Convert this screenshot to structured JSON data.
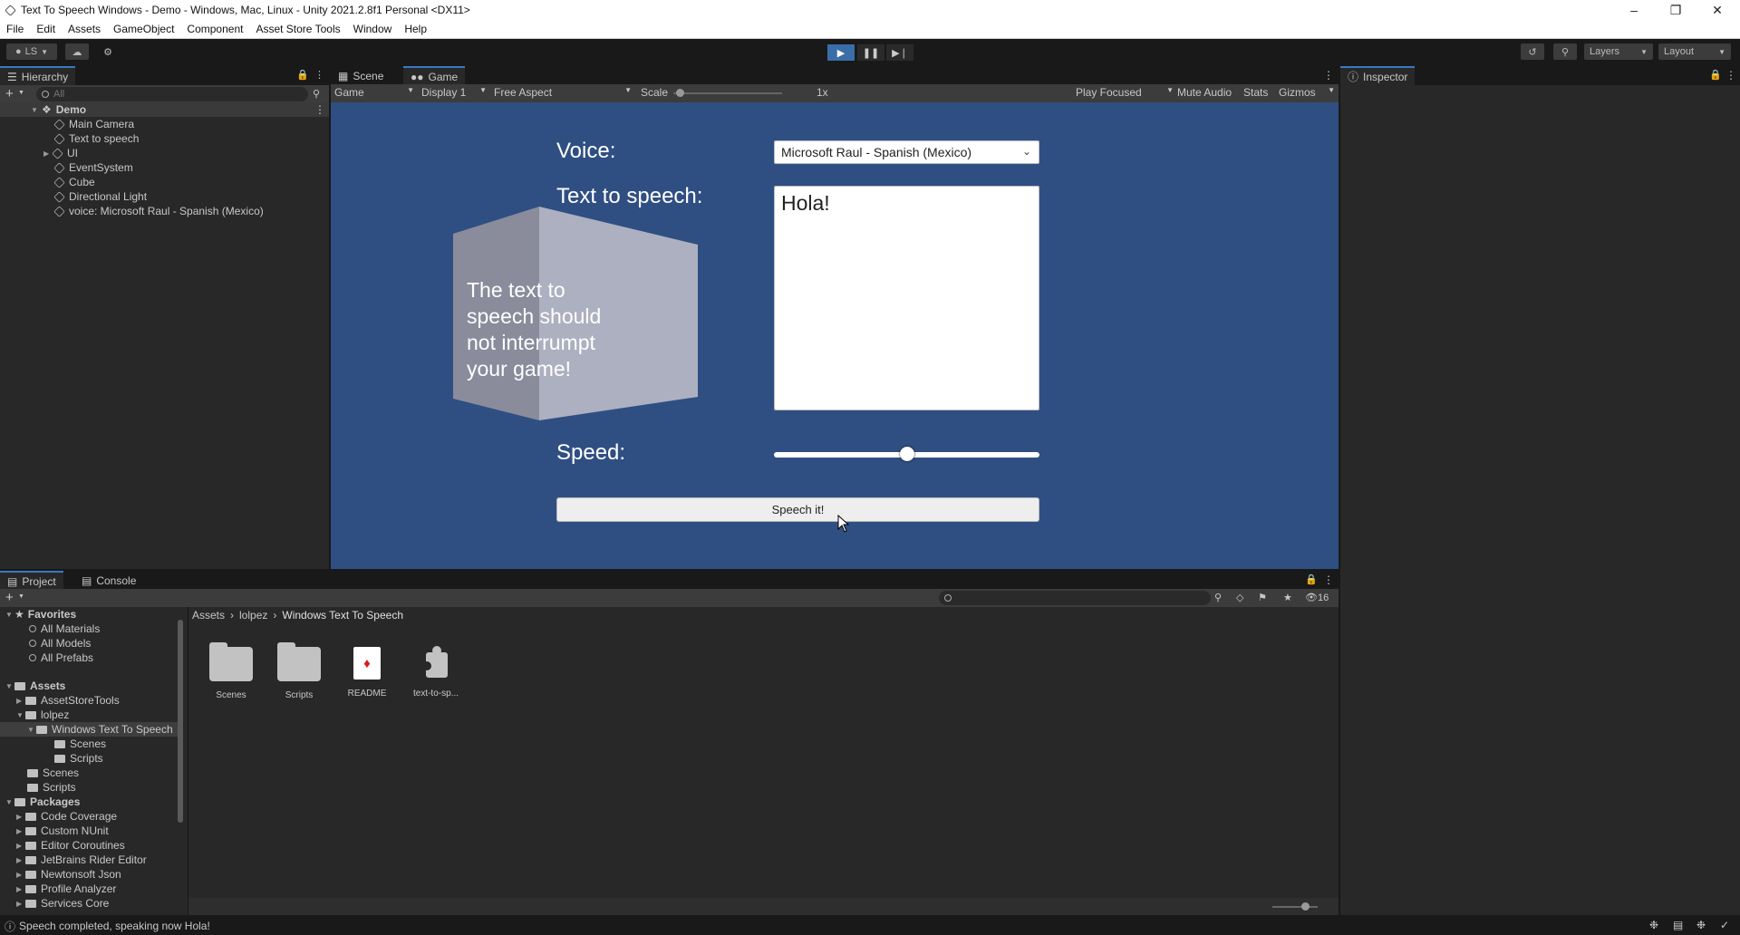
{
  "window": {
    "title": "Text To Speech Windows - Demo - Windows, Mac, Linux - Unity 2021.2.8f1 Personal <DX11>"
  },
  "menu": [
    "File",
    "Edit",
    "Assets",
    "GameObject",
    "Component",
    "Asset Store Tools",
    "Window",
    "Help"
  ],
  "toolbar": {
    "account": "LS",
    "layers": "Layers",
    "layout": "Layout"
  },
  "hierarchy": {
    "tab": "Hierarchy",
    "search_placeholder": "All",
    "scene": "Demo",
    "items": [
      "Main Camera",
      "Text to speech",
      "UI",
      "EventSystem",
      "Cube",
      "Directional Light",
      "voice: Microsoft Raul - Spanish (Mexico)"
    ]
  },
  "tabs": {
    "scene": "Scene",
    "game": "Game",
    "inspector": "Inspector",
    "project": "Project",
    "console": "Console"
  },
  "game_bar": {
    "game": "Game",
    "display": "Display 1",
    "aspect": "Free Aspect",
    "scale_label": "Scale",
    "scale_value": "1x",
    "play_focused": "Play Focused",
    "mute_audio": "Mute Audio",
    "stats": "Stats",
    "gizmos": "Gizmos"
  },
  "game": {
    "voice_label": "Voice:",
    "voice_value": "Microsoft Raul - Spanish (Mexico)",
    "tts_label": "Text to speech:",
    "tts_value": "Hola!",
    "cube_text": "The text to speech should not interrumpt your game!",
    "speed_label": "Speed:",
    "speed_value": 0.5,
    "button": "Speech it!"
  },
  "project": {
    "favorites": "Favorites",
    "favorite_items": [
      "All Materials",
      "All Models",
      "All Prefabs"
    ],
    "assets": "Assets",
    "asset_tree": [
      "AssetStoreTools",
      "lolpez",
      "Windows Text To Speech",
      "Scenes",
      "Scripts",
      "Scenes",
      "Scripts"
    ],
    "packages": "Packages",
    "package_items": [
      "Code Coverage",
      "Custom NUnit",
      "Editor Coroutines",
      "JetBrains Rider Editor",
      "Newtonsoft Json",
      "Profile Analyzer",
      "Services Core"
    ],
    "breadcrumb": [
      "Assets",
      "lolpez",
      "Windows Text To Speech"
    ],
    "files": [
      "Scenes",
      "Scripts",
      "README",
      "text-to-sp..."
    ],
    "hidden_count": "16"
  },
  "status": {
    "message": "Speech completed, speaking now Hola!"
  }
}
